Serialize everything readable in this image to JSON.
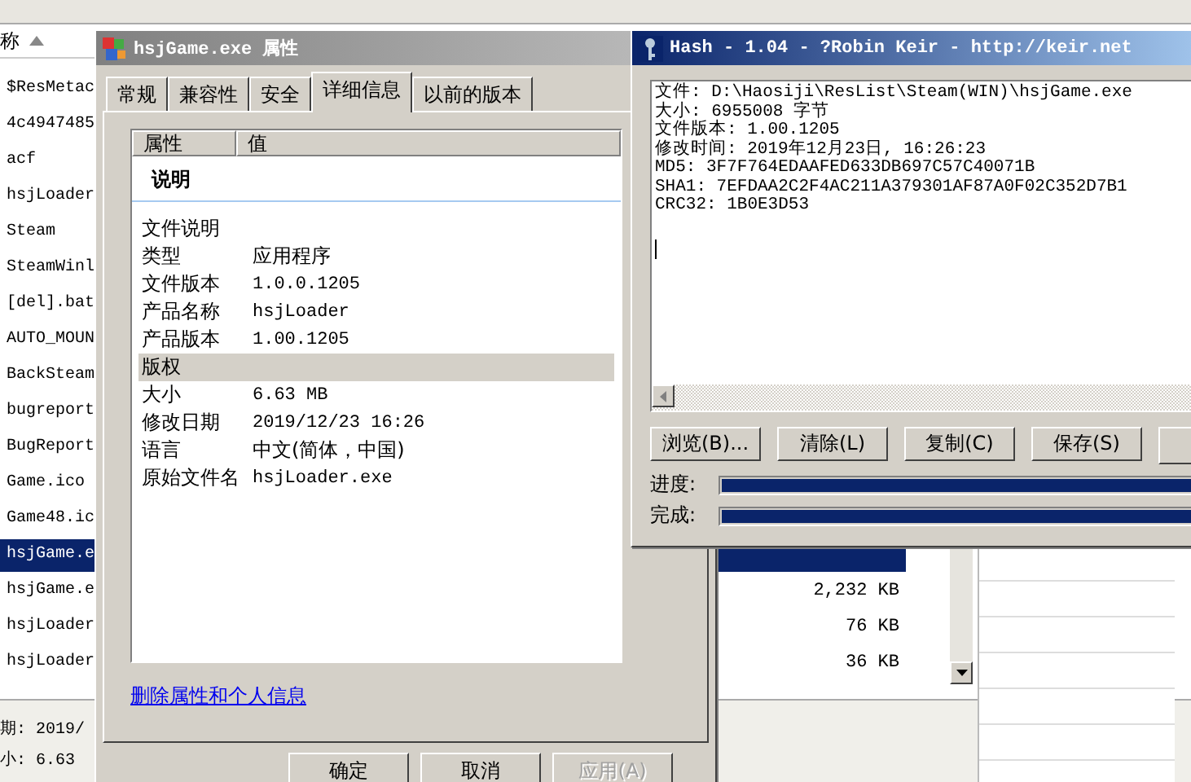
{
  "explorer": {
    "name_header": "称",
    "files": [
      {
        "name": "$ResMetac",
        "selected": false
      },
      {
        "name": "4c4947485",
        "selected": false
      },
      {
        "name": "acf",
        "selected": false
      },
      {
        "name": "hsjLoader",
        "selected": false
      },
      {
        "name": "Steam",
        "selected": false
      },
      {
        "name": "SteamWinl",
        "selected": false
      },
      {
        "name": "[del].bat",
        "selected": false
      },
      {
        "name": "AUTO_MOUN",
        "selected": false
      },
      {
        "name": "BackSteam",
        "selected": false
      },
      {
        "name": "bugreport",
        "selected": false
      },
      {
        "name": "BugReport",
        "selected": false
      },
      {
        "name": "Game.ico",
        "selected": false
      },
      {
        "name": "Game48.ic",
        "selected": false
      },
      {
        "name": "hsjGame.e",
        "selected": true
      },
      {
        "name": "hsjGame.e",
        "size": "2,232 KB",
        "selected": false
      },
      {
        "name": "hsjLoader",
        "size": "76 KB",
        "selected": false
      },
      {
        "name": "hsjLoader",
        "size": "36 KB",
        "selected": false
      }
    ],
    "details": [
      "期: 2019/",
      "小: 6.63"
    ]
  },
  "properties_dialog": {
    "title": "hsjGame.exe 属性",
    "tabs": [
      {
        "label": "常规",
        "selected": false
      },
      {
        "label": "兼容性",
        "selected": false
      },
      {
        "label": "安全",
        "selected": false
      },
      {
        "label": "详细信息",
        "selected": true
      },
      {
        "label": "以前的版本",
        "selected": false
      }
    ],
    "columns": [
      "属性",
      "值"
    ],
    "rows": [
      {
        "kind": "group",
        "label": "说明"
      },
      {
        "kind": "field",
        "label": "文件说明",
        "selected": false
      },
      {
        "kind": "field",
        "label": "类型",
        "value": "应用程序",
        "selected": false
      },
      {
        "kind": "field",
        "label": "文件版本",
        "value": "1.0.0.1205",
        "selected": false
      },
      {
        "kind": "field",
        "label": "产品名称",
        "value": "hsjLoader",
        "selected": false
      },
      {
        "kind": "field",
        "label": "产品版本",
        "value": "1.00.1205",
        "selected": false
      },
      {
        "kind": "field",
        "label": "版权",
        "selected": true
      },
      {
        "kind": "field",
        "label": "大小",
        "value": "6.63 MB",
        "selected": false
      },
      {
        "kind": "field",
        "label": "修改日期",
        "value": "2019/12/23 16:26",
        "selected": false
      },
      {
        "kind": "field",
        "label": "语言",
        "value": "中文(简体，中国)",
        "selected": false
      },
      {
        "kind": "field",
        "label": "原始文件名",
        "value": "hsjLoader.exe",
        "selected": false
      }
    ],
    "link": "删除属性和个人信息",
    "buttons": [
      {
        "label": "确定",
        "disabled": false
      },
      {
        "label": "取消",
        "disabled": false
      },
      {
        "label": "应用(A)",
        "disabled": true
      }
    ]
  },
  "hash_window": {
    "title": "Hash - 1.04 - ?Robin Keir - http://keir.net",
    "lines": [
      "文件: D:\\Haosiji\\ResList\\Steam(WIN)\\hsjGame.exe",
      "大小: 6955008 字节",
      "文件版本: 1.00.1205",
      "修改时间: 2019年12月23日, 16:26:23",
      "MD5: 3F7F764EDAAFED633DB697C57C40071B",
      "SHA1: 7EFDAA2C2F4AC211A379301AF87A0F02C352D7B1",
      "CRC32: 1B0E3D53"
    ],
    "buttons": [
      "浏览(B)...",
      "清除(L)",
      "复制(C)",
      "保存(S)"
    ],
    "progress": [
      {
        "label": "进度:",
        "level": 1
      },
      {
        "label": "完成:",
        "level": 1
      }
    ]
  }
}
